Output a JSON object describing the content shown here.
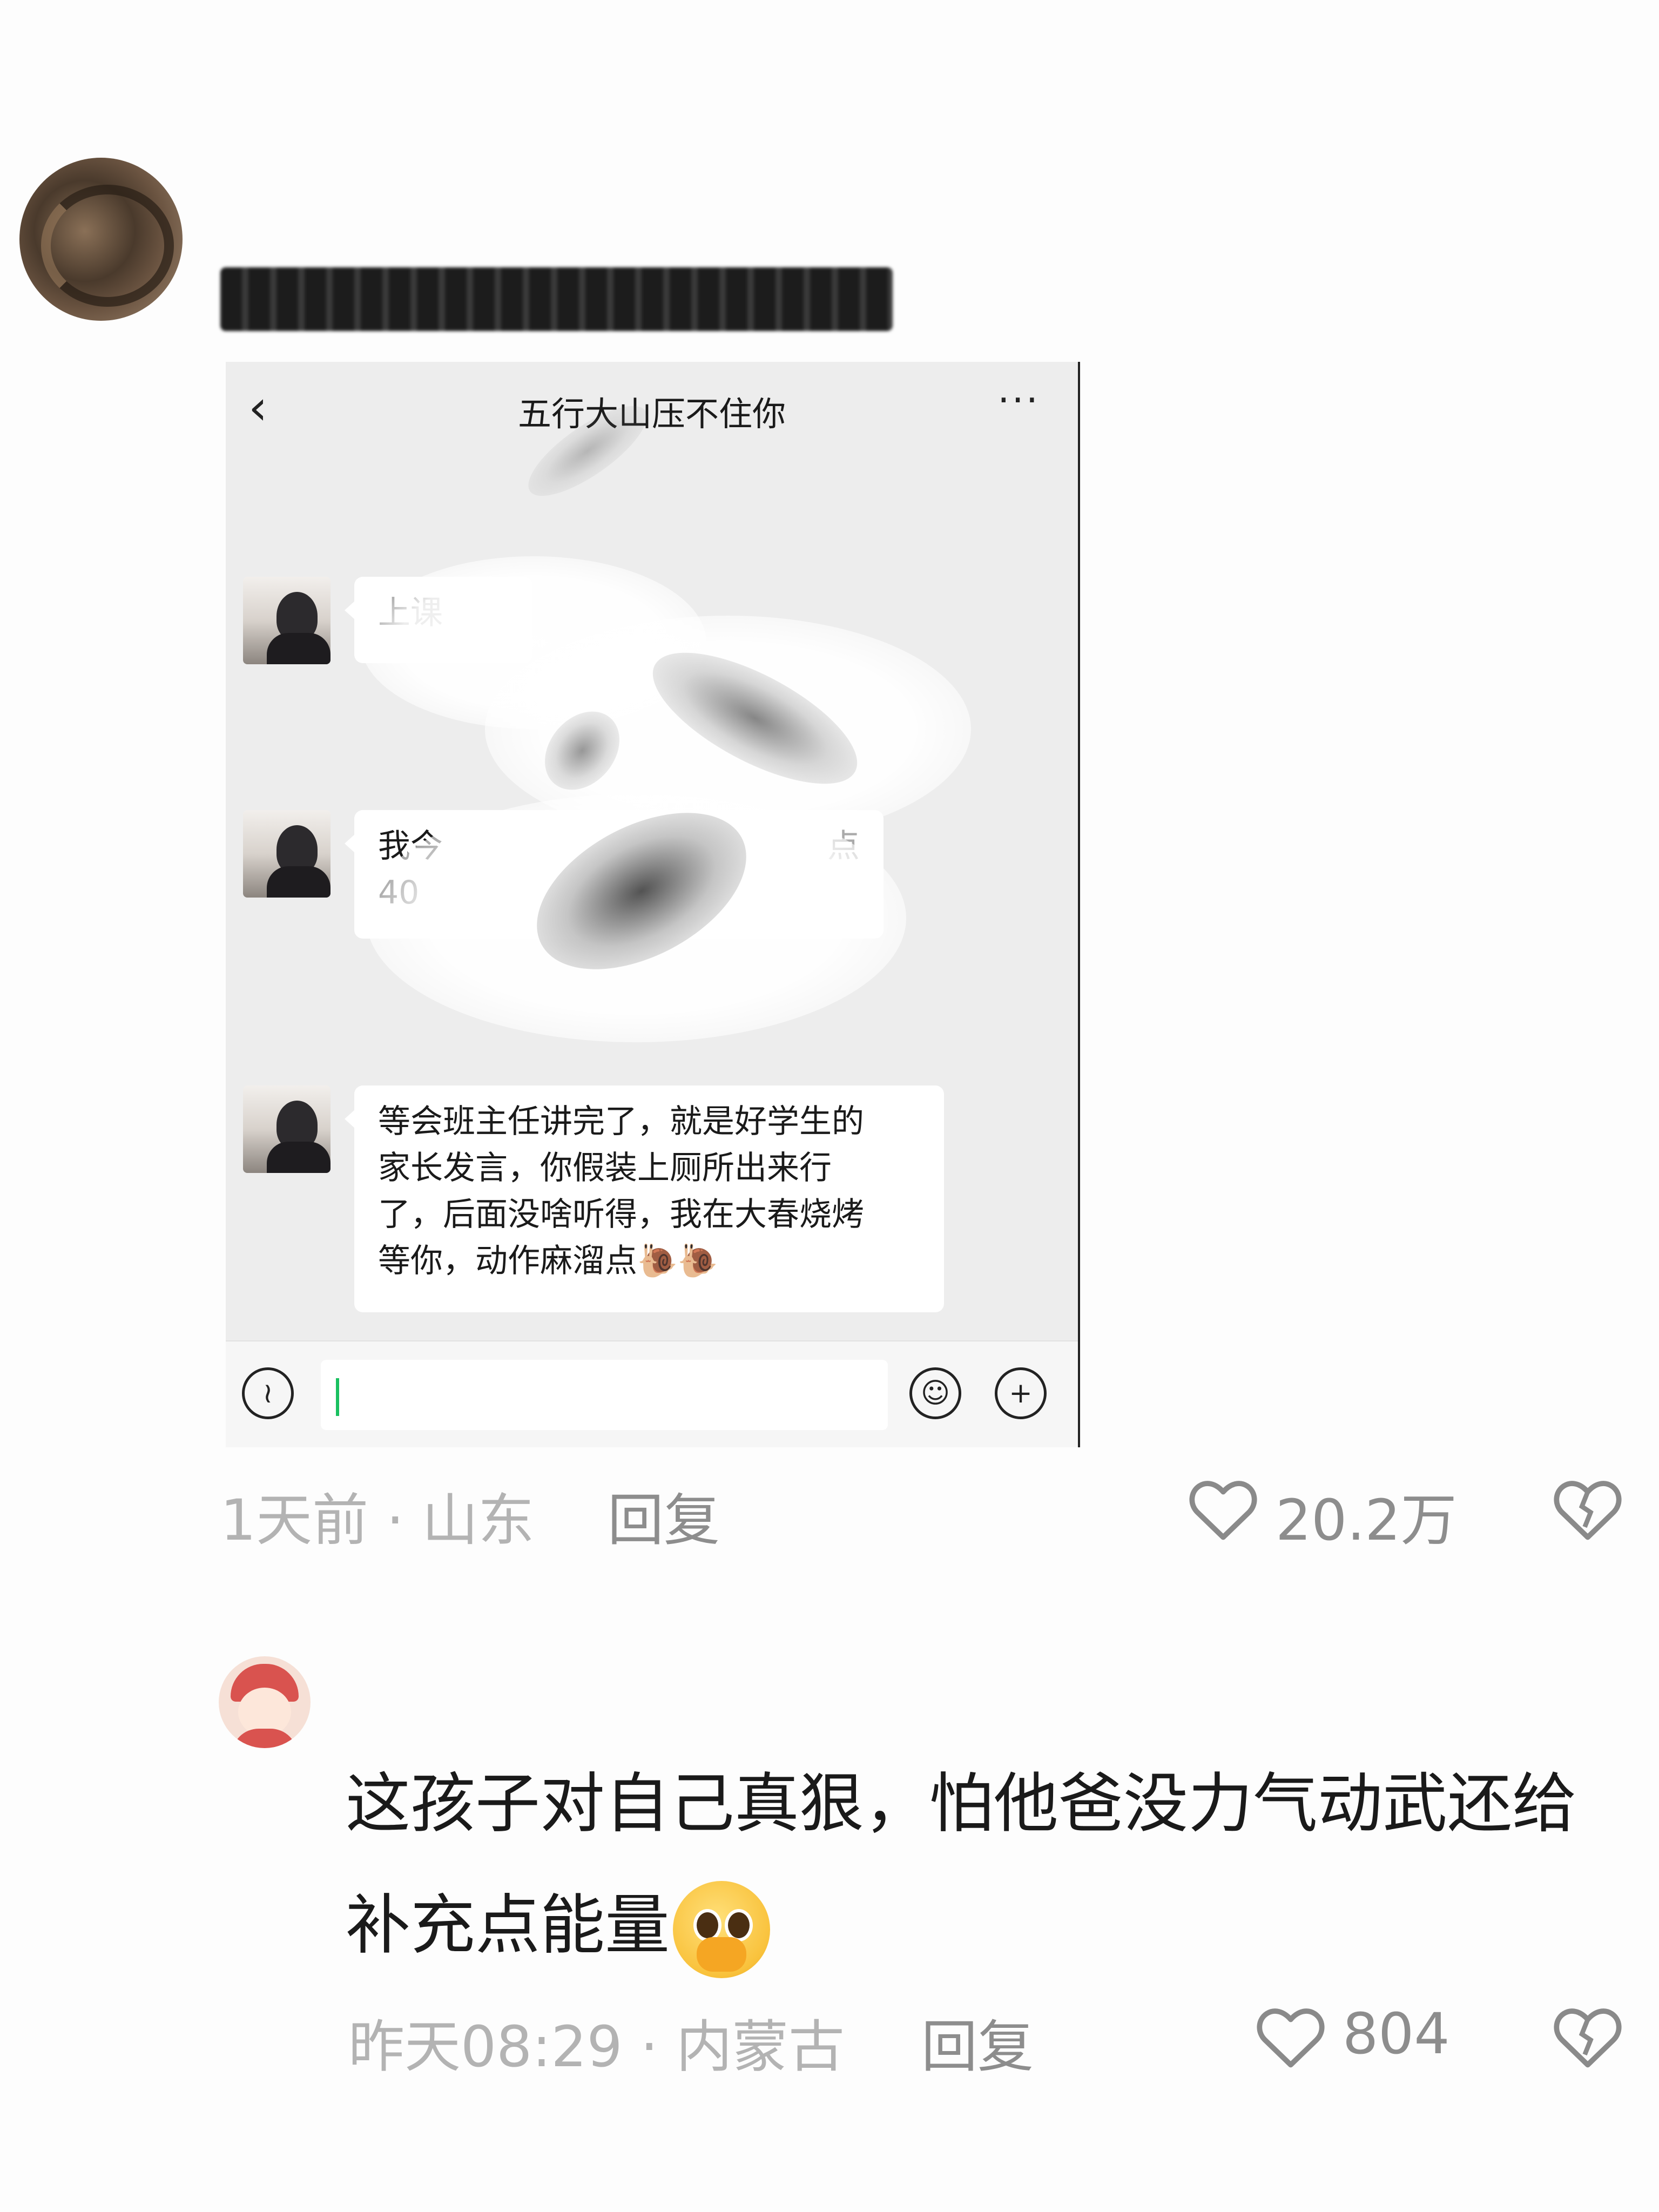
{
  "comment1": {
    "location_time": "1天前 · 山东",
    "reply_label": "回复",
    "like_count": "20.2万"
  },
  "chat": {
    "title": "五行大山压不住你",
    "msg1_visible": "上课",
    "msg2_line1": "我今",
    "msg2_line2": "40",
    "msg2_tail": "点",
    "msg3_lines": [
      "等会班主任讲完了，就是好学生的",
      "家长发言，你假装上厕所出来行",
      "了，后面没啥听得，我在大春烧烤",
      "等你，动作麻溜点"
    ],
    "msg3_emoji": "🐌🐌"
  },
  "comment2": {
    "text_line1": "这孩子对自己真狠，怕他爸没力气动武还给",
    "text_line2": "补充点能量",
    "location_time": "昨天08:29 · 内蒙古",
    "reply_label": "回复",
    "like_count": "804"
  },
  "icons": {
    "like": "heart-outline-icon",
    "dislike": "broken-heart-icon",
    "voice": "voice-icon",
    "emoji": "emoji-icon",
    "add": "plus-icon"
  }
}
